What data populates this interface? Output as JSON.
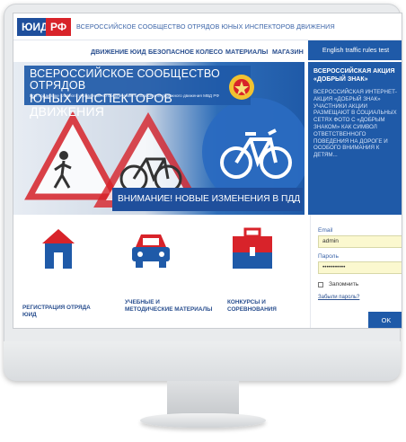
{
  "header": {
    "logo_left": "ЮИД",
    "logo_right": "РФ",
    "org_name": "ВСЕРОССИЙСКОЕ СООБЩЕСТВО ОТРЯДОВ ЮНЫХ ИНСПЕКТОРОВ ДВИЖЕНИЯ"
  },
  "nav": {
    "items": [
      "ДВИЖЕНИЕ ЮИД",
      "БЕЗОПАСНОЕ КОЛЕСО",
      "МАТЕРИАЛЫ",
      "МАГАЗИН"
    ],
    "english": "English traffic rules test"
  },
  "banner": {
    "title_line1": "ВСЕРОССИЙСКОЕ СООБЩЕСТВО ОТРЯДОВ",
    "title_line2": "ЮНЫХ ИНСПЕКТОРОВ ДВИЖЕНИЯ",
    "subtitle": "При поддержке Главного управления по обеспечению безопасности дорожного движения МВД РФ",
    "notice": "ВНИМАНИЕ! НОВЫЕ ИЗМЕНЕНИЯ В ПДД"
  },
  "news": {
    "title": "ВСЕРОССИЙСКАЯ АКЦИЯ «ДОБРЫЙ ЗНАК»",
    "text": "ВСЕРОССИЙСКАЯ ИНТЕРНЕТ-АКЦИЯ «ДОБРЫЙ ЗНАК» УЧАСТНИКИ АКЦИИ РАЗМЕЩАЮТ В СОЦИАЛЬНЫХ СЕТЯХ ФОТО С «ДОБРЫМ ЗНАКОМ» КАК СИМВОЛ ОТВЕТСТВЕННОГО ПОВЕДЕНИЯ НА ДОРОГЕ И ОСОБОГО ВНИМАНИЯ К ДЕТЯМ..."
  },
  "services": [
    {
      "line1": "РЕГИСТРАЦИЯ ОТРЯДА",
      "line2": "ЮИД",
      "icon": "house-icon"
    },
    {
      "line1": "УЧЕБНЫЕ  И",
      "line2": "МЕТОДИЧЕСКИЕ МАТЕРИАЛЫ",
      "icon": "car-icon"
    },
    {
      "line1": "КОНКУРСЫ И",
      "line2": "СОРЕВНОВАНИЯ",
      "icon": "case-icon"
    }
  ],
  "login": {
    "email_label": "Email",
    "email_value": "admin",
    "password_label": "Пароль",
    "password_value": "•••••••••••",
    "remember": "Запомнить",
    "forgot": "Забыли пароль?",
    "submit": "OK"
  },
  "colors": {
    "brand_blue": "#1f5aa8",
    "brand_red": "#d8232a",
    "input_bg": "#fbf8cf"
  }
}
